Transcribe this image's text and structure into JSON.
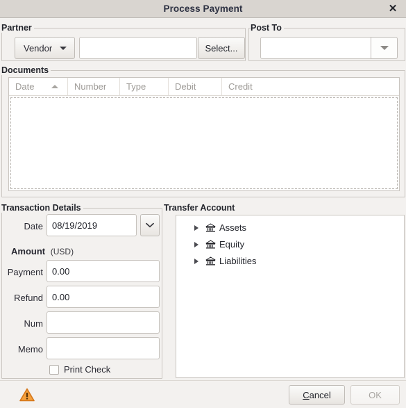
{
  "window": {
    "title": "Process Payment",
    "close_label": "✕"
  },
  "partner": {
    "group_title": "Partner",
    "type_value": "Vendor",
    "name_value": "",
    "name_placeholder": "",
    "select_label": "Select..."
  },
  "post_to": {
    "group_title": "Post To",
    "value": "",
    "placeholder": ""
  },
  "documents": {
    "group_title": "Documents",
    "columns": [
      {
        "label": "Date",
        "sorted": "asc"
      },
      {
        "label": "Number",
        "sorted": ""
      },
      {
        "label": "Type",
        "sorted": ""
      },
      {
        "label": "Debit",
        "sorted": ""
      },
      {
        "label": "Credit",
        "sorted": ""
      }
    ],
    "rows": []
  },
  "transaction_details": {
    "group_title": "Transaction Details",
    "date_label": "Date",
    "date_value": "08/19/2019",
    "amount_label": "Amount",
    "amount_currency": "(USD)",
    "payment_label": "Payment",
    "payment_value": "0.00",
    "refund_label": "Refund",
    "refund_value": "0.00",
    "num_label": "Num",
    "num_value": "",
    "memo_label": "Memo",
    "memo_value": "",
    "print_check_label": "Print Check",
    "print_check_checked": false
  },
  "transfer_account": {
    "group_title": "Transfer Account",
    "nodes": [
      {
        "label": "Assets",
        "expanded": false,
        "icon": "bank-icon"
      },
      {
        "label": "Equity",
        "expanded": false,
        "icon": "bank-icon"
      },
      {
        "label": "Liabilities",
        "expanded": false,
        "icon": "bank-icon"
      }
    ]
  },
  "footer": {
    "warning_icon": "warning-triangle-icon",
    "cancel_label": "Cancel",
    "cancel_mnemonic": "C",
    "ok_label": "OK",
    "ok_enabled": false
  },
  "colors": {
    "titlebar": "#d9d5d0",
    "body": "#f3f1ef",
    "field": "#ffffff",
    "border": "#c9c5c0",
    "header_text": "#9d9a96",
    "warning": "#e8821e"
  }
}
